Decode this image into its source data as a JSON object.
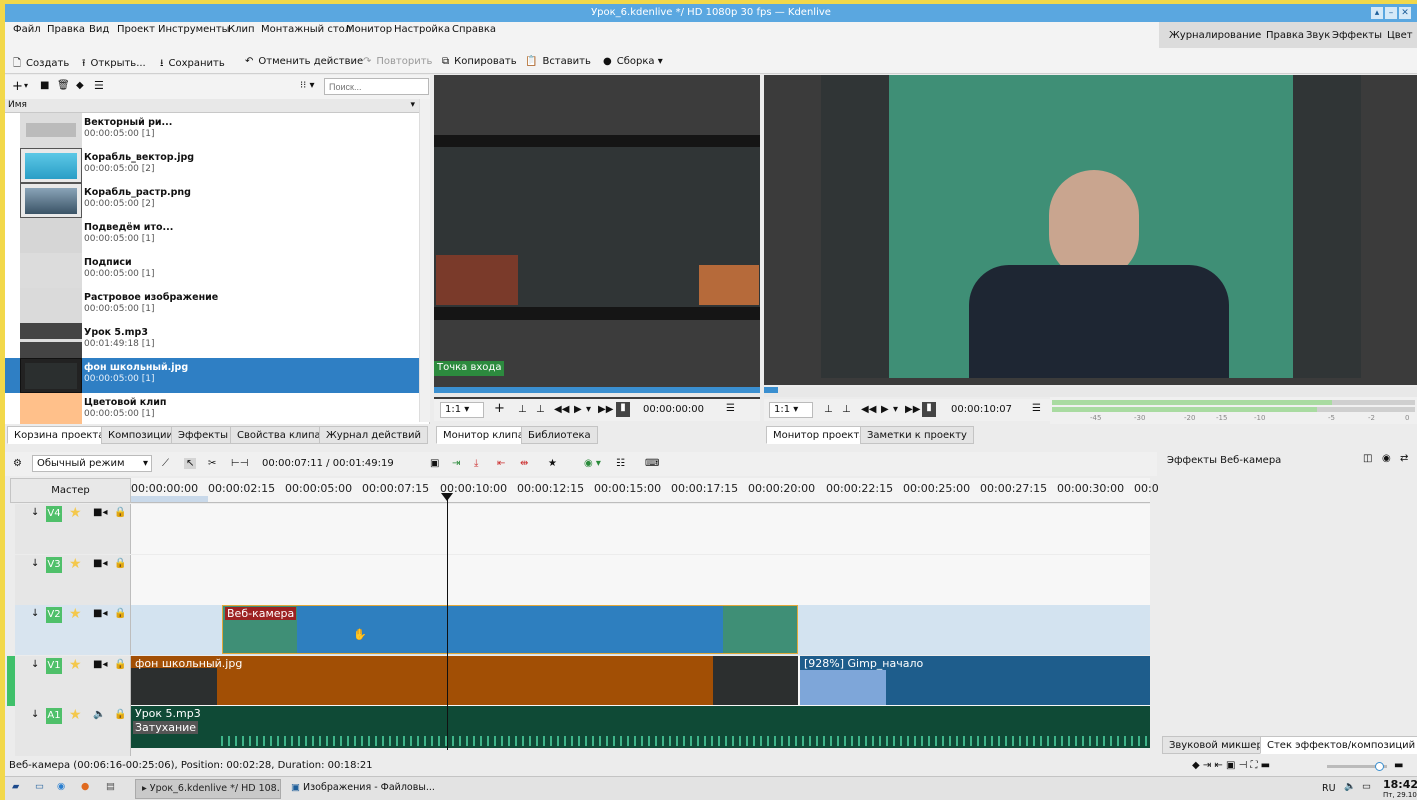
{
  "window": {
    "title": "Урок_6.kdenlive */ HD 1080p 30 fps — Kdenlive"
  },
  "menu": [
    "Файл",
    "Правка",
    "Вид",
    "Проект",
    "Инструменты",
    "Клип",
    "Монтажный стол",
    "Монитор",
    "Настройка",
    "Справка"
  ],
  "workspaces": [
    "Журналирование",
    "Правка",
    "Звук",
    "Эффекты",
    "Цвет"
  ],
  "toolbar": {
    "create": "Создать",
    "open": "Открыть...",
    "save": "Сохранить",
    "undo": "Отменить действие",
    "redo": "Повторить",
    "copy": "Копировать",
    "paste": "Вставить",
    "render": "Сборка"
  },
  "bin": {
    "search_placeholder": "Поиск...",
    "column_header": "Имя",
    "items": [
      {
        "name": "Векторный ри...",
        "duration": "00:00:05:00 [1]"
      },
      {
        "name": "Корабль_вектор.jpg",
        "duration": "00:00:05:00 [2]"
      },
      {
        "name": "Корабль_растр.png",
        "duration": "00:00:05:00 [2]"
      },
      {
        "name": "Подведём ито...",
        "duration": "00:00:05:00 [1]"
      },
      {
        "name": "Подписи",
        "duration": "00:00:05:00 [1]"
      },
      {
        "name": "Растровое изображение",
        "duration": "00:00:05:00 [1]"
      },
      {
        "name": "Урок 5.mp3",
        "duration": "00:01:49:18 [1]"
      },
      {
        "name": "фон школьный.jpg",
        "duration": "00:00:05:00 [1]"
      },
      {
        "name": "Цветовой клип",
        "duration": "00:00:05:00 [1]"
      }
    ],
    "tabs": [
      "Корзина проекта",
      "Композиции",
      "Эффекты",
      "Свойства клипа",
      "Журнал действий"
    ]
  },
  "clip_monitor": {
    "in_point_label": "Точка  входа",
    "zoom": "1:1",
    "timecode": "00:00:00:00",
    "tabs": [
      "Монитор клипа",
      "Библиотека"
    ]
  },
  "project_monitor": {
    "zoom": "1:1",
    "timecode": "00:00:10:07",
    "tabs": [
      "Монитор проекта",
      "Заметки к проекту"
    ],
    "meter_scale": [
      "-45",
      "-30",
      "-20",
      "-15",
      "-10",
      "-5",
      "-2",
      "0"
    ]
  },
  "timeline": {
    "mode": "Обычный режим",
    "position": "00:00:07:11 / 00:01:49:19",
    "master_label": "Мастер",
    "ruler": [
      "00:00:00:00",
      "00:00:02:15",
      "00:00:05:00",
      "00:00:07:15",
      "00:00:10:00",
      "00:00:12:15",
      "00:00:15:00",
      "00:00:17:15",
      "00:00:20:00",
      "00:00:22:15",
      "00:00:25:00",
      "00:00:27:15",
      "00:00:30:00",
      "00:0"
    ],
    "tracks": [
      {
        "name": "V4"
      },
      {
        "name": "V3"
      },
      {
        "name": "V2"
      },
      {
        "name": "V1"
      },
      {
        "name": "A1"
      }
    ],
    "clips": {
      "webcam": "Веб-камера",
      "background": "фон школьный.jpg",
      "gimp": "[928%] Gimp_начало",
      "audio": "Урок 5.mp3",
      "fade": "Затухание"
    }
  },
  "effects_panel": {
    "title": "Эффекты Веб-камера",
    "tabs": [
      "Звуковой микшер",
      "Стек эффектов/композиций"
    ]
  },
  "status": "Веб-камера (00:06:16-00:25:06), Position: 00:02:28, Duration: 00:18:21",
  "taskbar": {
    "task1": "Урок_6.kdenlive */ HD 108...",
    "task2": "Изображения - Файловы...",
    "lang": "RU",
    "time": "18:42",
    "date": "Пт, 29.10"
  }
}
